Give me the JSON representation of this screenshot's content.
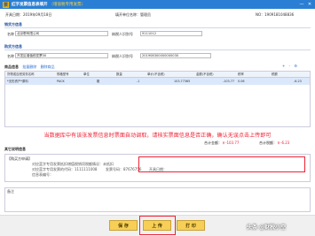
{
  "app": {
    "logo": "票",
    "title": "红字发票信息表填开",
    "subtitle": "（增值税专用发票）",
    "close": "✕",
    "minimize": "—"
  },
  "header": {
    "date_label": "开具日期：",
    "date": "2019年09月18日",
    "dept_label": "填开单位名称：",
    "dept": "管理员",
    "no_label": "NO：",
    "no": "1909181048836"
  },
  "seller": {
    "section": "销货方信息",
    "name_label": "名称",
    "name": "北京嘢有限公司",
    "tax_label": "纳税人识别号",
    "tax": "9111012"
  },
  "buyer": {
    "section": "购货方信息",
    "name_label": "名称",
    "name": "开发区增值税发票30",
    "tax_label": "纳税人识别号",
    "tax": "201908300000000030"
  },
  "goods": {
    "section": "商品信息",
    "link1": "批量删除",
    "link2": "删除商品",
    "columns": [
      "货物或应税劳务名称",
      "规格型号",
      "单位",
      "数量",
      "单价(不含税)",
      "金额(不含税)",
      "税率",
      "税额"
    ],
    "rows": [
      {
        "name": "*无形资产*原料",
        "spec": "PACK",
        "unit": "箱",
        "qty": "-1",
        "price": "103.77365",
        "amount": "-103.77",
        "rate": "0.06",
        "tax": "-6.23"
      }
    ],
    "icons": [
      "+",
      "-",
      "⚙"
    ],
    "total_amount_label": "合计金额：",
    "total_amount": "￥-103.77",
    "total_tax_label": "合计税额：",
    "total_tax": "￥-6.23"
  },
  "other": {
    "section": "其它说明信息",
    "box_title": "【购买方申请】",
    "line1": "对应蓝字专用发票抵扣增值税销项税额情况：未抵扣",
    "line2_a": "对应蓝字专用发票的代码：1111111008",
    "line2_b": "发票号码：87676756",
    "line2_c": "开具日期：",
    "line3": "信息表编号：",
    "annot_label": "备注"
  },
  "notice": "当数据库中有该张发票信息时票面自动调取，请核实票面信息是否正确，确认无误点击上传即可",
  "buttons": {
    "save": "保 存",
    "upload": "上 传",
    "print": "打 印"
  },
  "watermark": "头条 @财税小空"
}
